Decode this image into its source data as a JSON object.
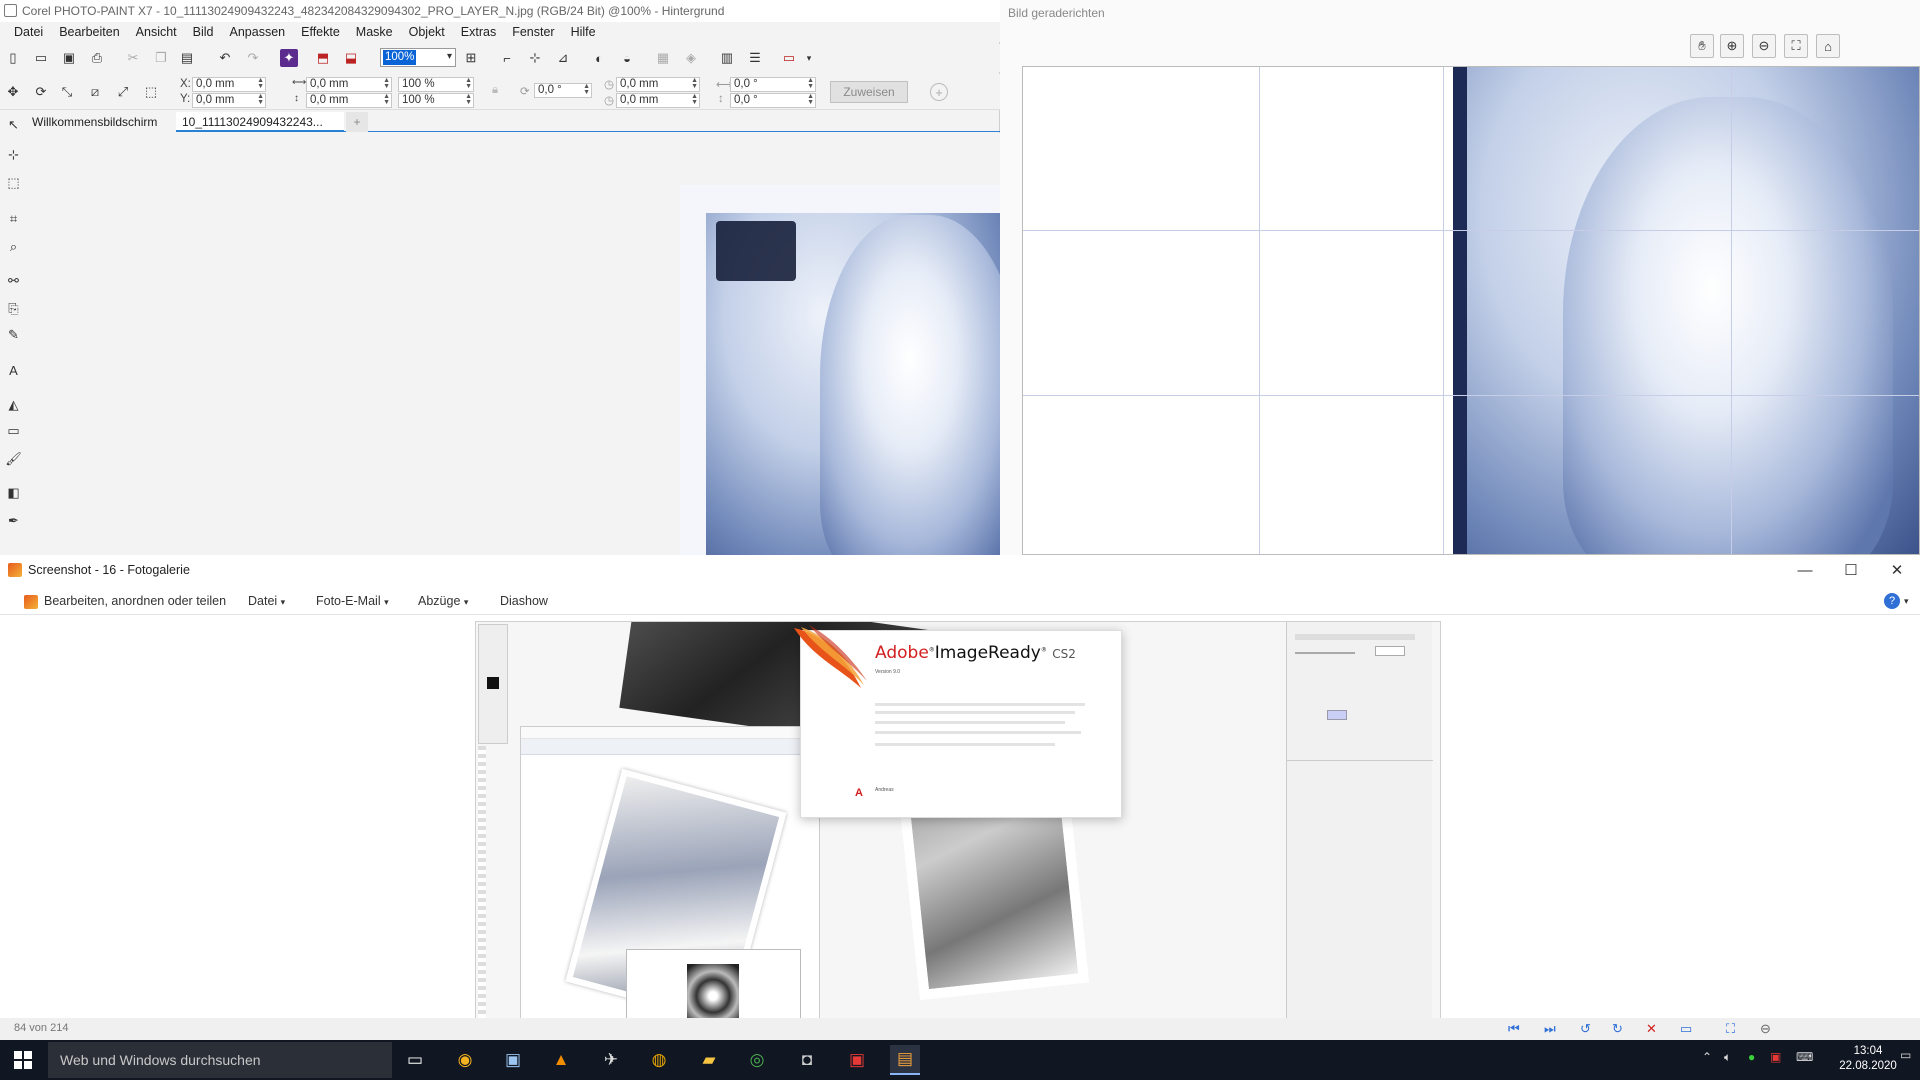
{
  "corel": {
    "title": "Corel PHOTO-PAINT X7 - 10_11113024909432243_482342084329094302_PRO_LAYER_N.jpg (RGB/24 Bit) @100% - Hintergrund",
    "menu": [
      "Datei",
      "Bearbeiten",
      "Ansicht",
      "Bild",
      "Anpassen",
      "Effekte",
      "Maske",
      "Objekt",
      "Extras",
      "Fenster",
      "Hilfe"
    ],
    "zoom_value": "100%",
    "props": {
      "x_label": "X:",
      "x_value": "0,0 mm",
      "y_label": "Y:",
      "y_value": "0,0 mm",
      "w_value": "0,0 mm",
      "h_value": "0,0 mm",
      "scale_w": "100 %",
      "scale_h": "100 %",
      "rotate": "0,0 °",
      "skew_x": "0,0 mm",
      "skew_y": "0,0 mm",
      "angle_1": "0,0 °",
      "angle_2": "0,0 °",
      "apply_label": "Zuweisen"
    },
    "tabs": [
      "Willkommensbildschirm",
      "10_11113024909432243..."
    ],
    "tab_add": "+"
  },
  "straighten": {
    "title": "Bild geraderichten"
  },
  "gallery": {
    "title": "Screenshot - 16 - Fotogalerie",
    "menu": [
      "Bearbeiten, anordnen oder teilen",
      "Datei",
      "Foto-E-Mail",
      "Abzüge",
      "Diashow"
    ],
    "help": "?",
    "status_count": "84 von 214",
    "splash": {
      "brand_adobe": "Adobe",
      "brand_name": "ImageReady",
      "brand_cs": "CS2",
      "version": "Version 9.0",
      "user": "Andreas"
    }
  },
  "taskbar": {
    "search_placeholder": "Web und Windows durchsuchen",
    "time": "13:04",
    "date": "22.08.2020"
  },
  "colors": {
    "accent": "#2a7fd6",
    "taskbar": "#101622",
    "photo_tint": "#6d86b8"
  }
}
